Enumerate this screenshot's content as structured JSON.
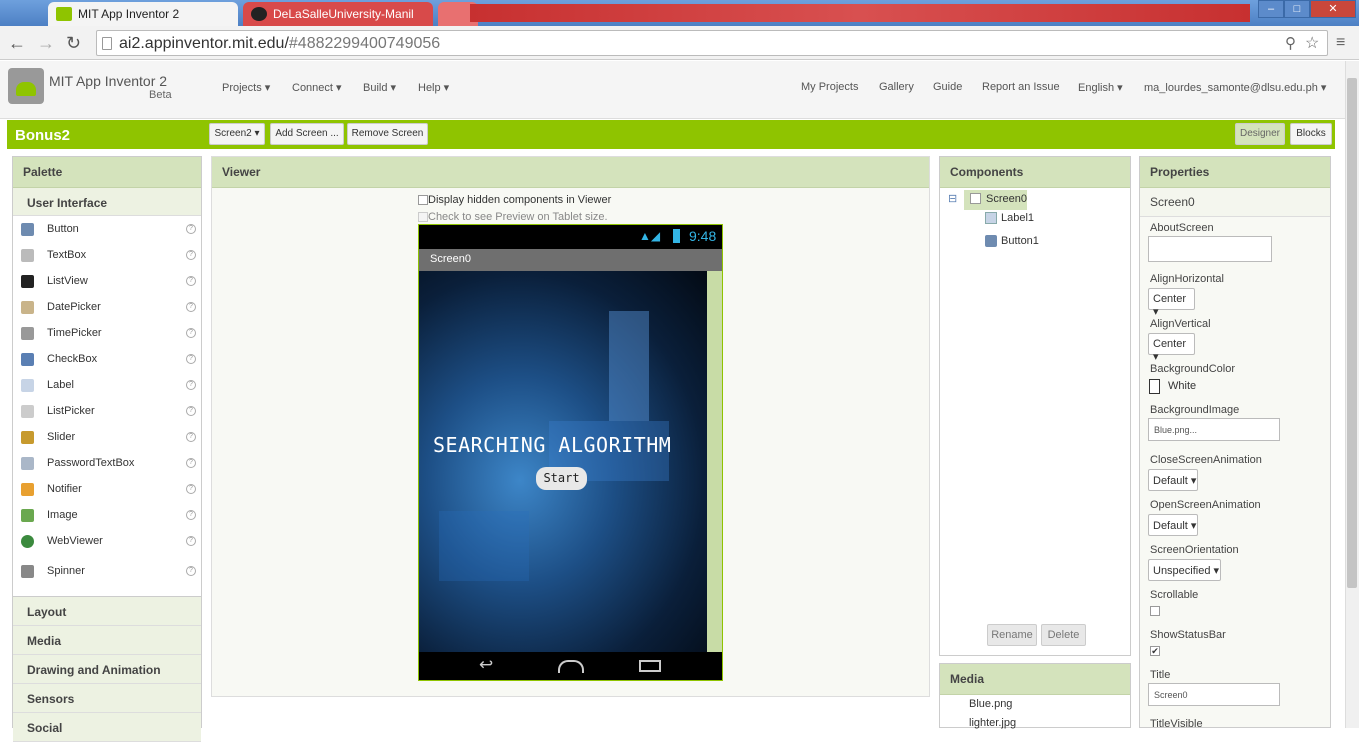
{
  "browser": {
    "tabs": [
      {
        "label": "MIT App Inventor 2"
      },
      {
        "label": "DeLaSalleUniversity-Manil"
      },
      {
        "label": ""
      }
    ],
    "url_host": "ai2.appinventor.mit.edu/",
    "url_hash": "#4882299400749056"
  },
  "app": {
    "name": "MIT App Inventor 2",
    "badge": "Beta",
    "menus": [
      "Projects ▾",
      "Connect ▾",
      "Build ▾",
      "Help ▾"
    ],
    "right_menus": [
      "My Projects",
      "Gallery",
      "Guide",
      "Report an Issue",
      "English ▾",
      "ma_lourdes_samonte@dlsu.edu.ph ▾"
    ]
  },
  "toolbar": {
    "project_name": "Bonus2",
    "screen_select": "Screen2 ▾",
    "add_screen": "Add Screen ...",
    "remove_screen": "Remove Screen",
    "designer": "Designer",
    "blocks": "Blocks"
  },
  "palette": {
    "title": "Palette",
    "section_open": "User Interface",
    "items": [
      "Button",
      "TextBox",
      "ListView",
      "DatePicker",
      "TimePicker",
      "CheckBox",
      "Label",
      "ListPicker",
      "Slider",
      "PasswordTextBox",
      "Notifier",
      "Image",
      "WebViewer",
      "Spinner"
    ],
    "help_glyph": "?",
    "sections": [
      "Layout",
      "Media",
      "Drawing and Animation",
      "Sensors",
      "Social"
    ]
  },
  "viewer": {
    "title": "Viewer",
    "hidden_components_label": "Display hidden components in Viewer",
    "tablet_preview_label": "Check to see Preview on Tablet size.",
    "phone": {
      "clock": "9:48",
      "screen_title": "Screen0",
      "label_text": "SEARCHING ALGORITHM",
      "button_text": "Start"
    }
  },
  "components": {
    "title": "Components",
    "collapse": "⊟",
    "root": "Screen0",
    "children": [
      "Label1",
      "Button1"
    ],
    "rename": "Rename",
    "delete": "Delete"
  },
  "media": {
    "title": "Media",
    "files": [
      "Blue.png",
      "lighter.jpg"
    ]
  },
  "properties": {
    "title": "Properties",
    "component": "Screen0",
    "about_label": "AboutScreen",
    "align_h_label": "AlignHorizontal",
    "align_h_value": "Center ▾",
    "align_v_label": "AlignVertical",
    "align_v_value": "Center ▾",
    "bgcolor_label": "BackgroundColor",
    "bgcolor_value": "White",
    "bgimage_label": "BackgroundImage",
    "bgimage_value": "Blue.png...",
    "close_anim_label": "CloseScreenAnimation",
    "close_anim_value": "Default ▾",
    "open_anim_label": "OpenScreenAnimation",
    "open_anim_value": "Default ▾",
    "orientation_label": "ScreenOrientation",
    "orientation_value": "Unspecified ▾",
    "scrollable_label": "Scrollable",
    "statusbar_label": "ShowStatusBar",
    "title_label": "Title",
    "title_value": "Screen0",
    "title_visible_label": "TitleVisible"
  },
  "colors": {
    "accent": "#8fc400",
    "panel_header": "#d4e3bc"
  }
}
